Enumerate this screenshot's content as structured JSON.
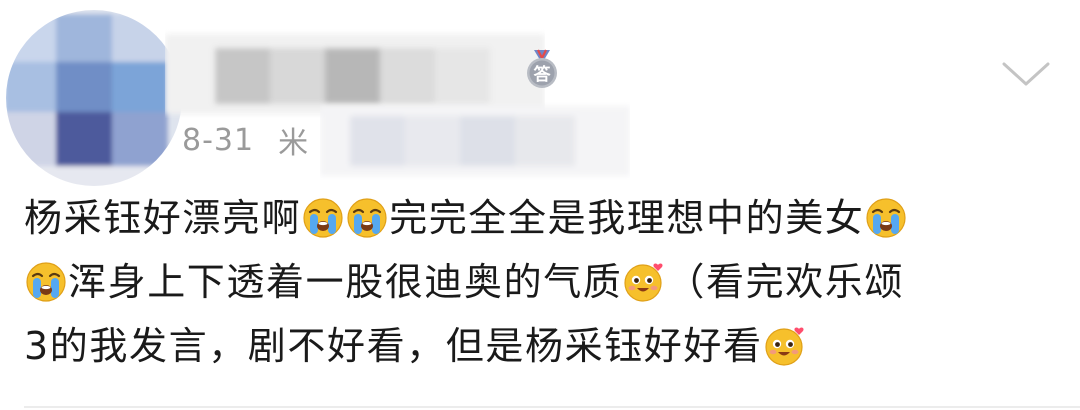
{
  "comment": {
    "date": "8-31",
    "source_partial": "米",
    "badge_char": "答",
    "line1": {
      "text_a": "杨采钰好漂亮啊",
      "text_b": "完完全全是我理想中的美女"
    },
    "line2": {
      "text_a": "浑身上下透着一股很迪奥的气质",
      "text_b": "（看完欢乐颂"
    },
    "line3": {
      "text_a": "3的我发言，剧不好看，但是杨采钰好好看"
    }
  },
  "icons": {
    "crying": "loudly-crying-face-icon",
    "adoring": "heart-eyes-face-icon",
    "chevron": "chevron-down-icon",
    "badge": "medal-badge-icon"
  },
  "colors": {
    "text": "#1a1a1a",
    "meta": "#9a9a9a",
    "chevron": "#c4c4c4",
    "emoji_face": "#f6c02c",
    "tear": "#56a8f0"
  }
}
